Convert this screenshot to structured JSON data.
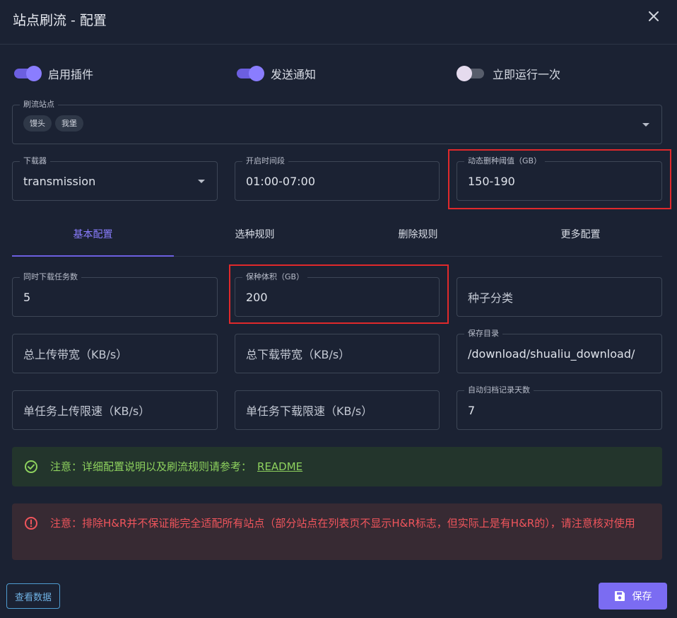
{
  "dialog": {
    "title": "站点刷流 - 配置"
  },
  "toggles": [
    {
      "label": "启用插件",
      "on": true
    },
    {
      "label": "发送通知",
      "on": true
    },
    {
      "label": "立即运行一次",
      "on": false
    }
  ],
  "sites": {
    "label": "刷流站点",
    "chips": [
      "馒头",
      "我堡"
    ]
  },
  "downloader": {
    "label": "下载器",
    "value": "transmission"
  },
  "time_range": {
    "label": "开启时间段",
    "value": "01:00-07:00"
  },
  "dynamic_threshold": {
    "label": "动态删种阈值（GB）",
    "value": "150-190"
  },
  "tabs": [
    "基本配置",
    "选种规则",
    "删除规则",
    "更多配置"
  ],
  "active_tab": "基本配置",
  "fields": {
    "concurrent_tasks": {
      "label": "同时下载任务数",
      "value": "5"
    },
    "seed_volume": {
      "label": "保种体积（GB）",
      "value": "200"
    },
    "torrent_category": {
      "placeholder": "种子分类"
    },
    "total_upload": {
      "placeholder": "总上传带宽（KB/s）"
    },
    "total_download": {
      "placeholder": "总下载带宽（KB/s）"
    },
    "save_dir": {
      "label": "保存目录",
      "value": "/download/shualiu_download/"
    },
    "task_upload_limit": {
      "placeholder": "单任务上传限速（KB/s）"
    },
    "task_download_limit": {
      "placeholder": "单任务下载限速（KB/s）"
    },
    "archive_days": {
      "label": "自动归档记录天数",
      "value": "7"
    }
  },
  "alerts": {
    "info": {
      "text": "注意：详细配置说明以及刷流规则请参考：",
      "link": "README"
    },
    "warning": {
      "text": "注意：排除H&R并不保证能完全适配所有站点（部分站点在列表页不显示H&R标志，但实际上是有H&R的），请注意核对使用"
    }
  },
  "footer": {
    "view_data": "查看数据",
    "save": "保存"
  },
  "colors": {
    "accent": "#7b6cf2",
    "highlight": "#e0292b",
    "success": "#8ed25e",
    "error": "#f0555c"
  }
}
